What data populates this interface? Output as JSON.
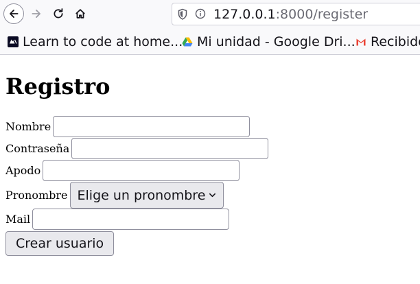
{
  "browser": {
    "url_host": "127.0.0.1",
    "url_path": ":8000/register",
    "bookmarks": [
      {
        "label": "Learn to code at home...",
        "icon": "codepen-icon"
      },
      {
        "label": "Mi unidad - Google Dri...",
        "icon": "google-drive-icon"
      },
      {
        "label": "Recibido",
        "icon": "gmail-icon"
      }
    ]
  },
  "page": {
    "title": "Registro",
    "form": {
      "nombre_label": "Nombre",
      "nombre_value": "",
      "contrasena_label": "Contraseña",
      "contrasena_value": "",
      "apodo_label": "Apodo",
      "apodo_value": "",
      "pronombre_label": "Pronombre",
      "pronombre_selected": "Elige un pronombre",
      "mail_label": "Mail",
      "mail_value": "",
      "submit_label": "Crear usuario"
    }
  },
  "colors": {
    "chrome_bg": "#f9f9fb",
    "button_bg": "#e9e9ed",
    "border": "#8f8f9d"
  }
}
